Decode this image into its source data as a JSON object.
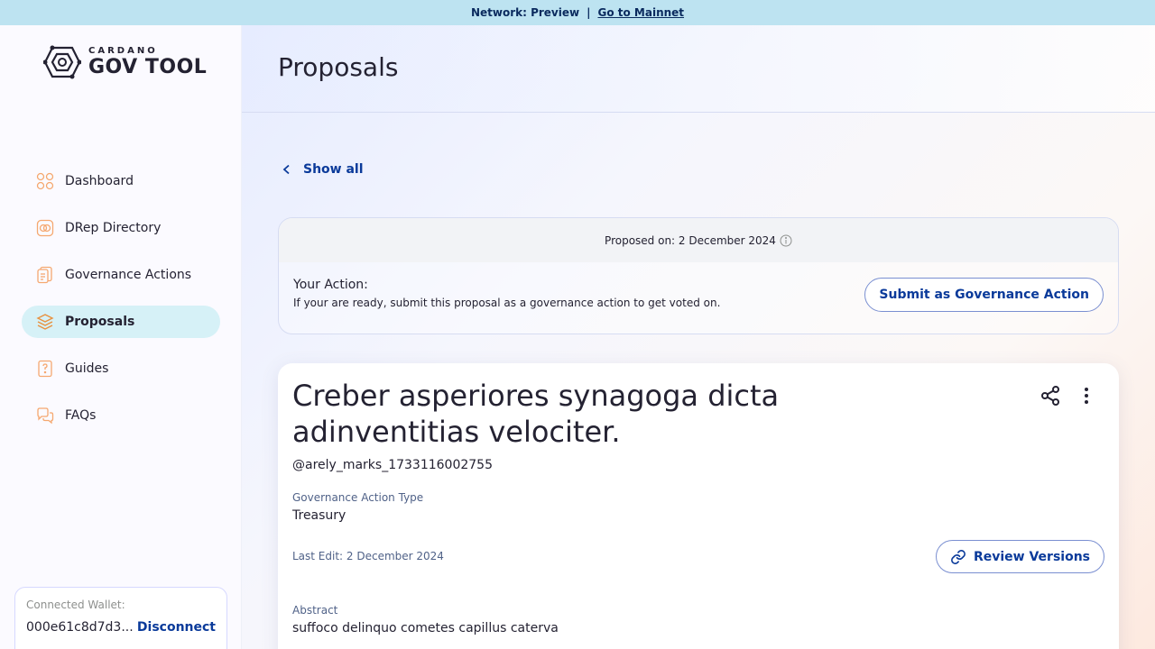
{
  "banner": {
    "network_text": "Network: Preview",
    "separator": "|",
    "mainnet_link": "Go to Mainnet"
  },
  "logo": {
    "small": "CARDANO",
    "big": "GOV TOOL"
  },
  "sidebar": {
    "items": [
      {
        "label": "Dashboard",
        "icon": "dashboard-icon"
      },
      {
        "label": "DRep Directory",
        "icon": "drep-directory-icon"
      },
      {
        "label": "Governance Actions",
        "icon": "governance-actions-icon"
      },
      {
        "label": "Proposals",
        "icon": "proposals-icon",
        "active": true
      },
      {
        "label": "Guides",
        "icon": "guides-icon"
      },
      {
        "label": "FAQs",
        "icon": "faqs-icon"
      }
    ]
  },
  "wallet": {
    "label": "Connected Wallet:",
    "address": "000e61c8d7d3...",
    "disconnect": "Disconnect"
  },
  "header": {
    "title": "Proposals"
  },
  "nav": {
    "show_all": "Show all"
  },
  "action_card": {
    "proposed_on": "Proposed on: 2 December 2024",
    "your_action": "Your Action:",
    "your_action_sub": "If your are ready, submit this proposal as a governance action to get voted on.",
    "submit_button": "Submit as Governance Action"
  },
  "proposal": {
    "title": "Creber asperiores synagoga dicta adinventitias velociter.",
    "author": "@arely_marks_1733116002755",
    "type_label": "Governance Action Type",
    "type_value": "Treasury",
    "last_edit": "Last Edit: 2 December 2024",
    "review_button": "Review Versions",
    "abstract_label": "Abstract",
    "abstract_value": "suffoco delinquo cometes capillus caterva"
  },
  "colors": {
    "banner": "#bde3f1",
    "accent": "#0a3a9a",
    "active_nav": "#d6f1f7",
    "icon_orange": "#f5a870"
  }
}
